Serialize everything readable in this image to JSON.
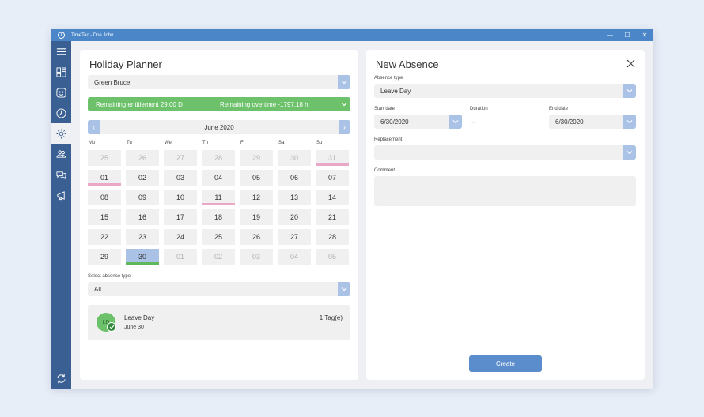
{
  "window": {
    "title": "TimeTac - Doe John",
    "minimize": "—",
    "maximize": "☐",
    "close": "✕",
    "app_icon": "T"
  },
  "sidebar": {
    "items": [
      {
        "icon": "hamburger-menu-icon"
      },
      {
        "icon": "dashboard-icon"
      },
      {
        "icon": "happy-face-icon"
      },
      {
        "icon": "clock-icon"
      },
      {
        "icon": "sun-icon",
        "active": true
      },
      {
        "icon": "team-icon"
      },
      {
        "icon": "chat-icon"
      },
      {
        "icon": "megaphone-icon"
      },
      {
        "icon": "sync-icon"
      }
    ]
  },
  "planner": {
    "title": "Holiday Planner",
    "employee": "Green Bruce",
    "remaining_entitlement": "Remaining entitlement 29.00 D",
    "remaining_overtime": "Remaining overtime -1797.18 h",
    "month": "June 2020",
    "prev": "‹",
    "next": "›",
    "weekdays": [
      "Mo",
      "Tu",
      "We",
      "Th",
      "Fr",
      "Sa",
      "Su"
    ],
    "weeks": [
      [
        {
          "d": "25",
          "o": true
        },
        {
          "d": "26",
          "o": true
        },
        {
          "d": "27",
          "o": true
        },
        {
          "d": "28",
          "o": true
        },
        {
          "d": "29",
          "o": true
        },
        {
          "d": "30",
          "o": true
        },
        {
          "d": "31",
          "o": true,
          "mark": "pink"
        }
      ],
      [
        {
          "d": "01",
          "mark": "pink"
        },
        {
          "d": "02"
        },
        {
          "d": "03"
        },
        {
          "d": "04"
        },
        {
          "d": "05"
        },
        {
          "d": "06"
        },
        {
          "d": "07"
        }
      ],
      [
        {
          "d": "08"
        },
        {
          "d": "09"
        },
        {
          "d": "10"
        },
        {
          "d": "11",
          "mark": "pink"
        },
        {
          "d": "12"
        },
        {
          "d": "13"
        },
        {
          "d": "14"
        }
      ],
      [
        {
          "d": "15"
        },
        {
          "d": "16"
        },
        {
          "d": "17"
        },
        {
          "d": "18"
        },
        {
          "d": "19"
        },
        {
          "d": "20"
        },
        {
          "d": "21"
        }
      ],
      [
        {
          "d": "22"
        },
        {
          "d": "23"
        },
        {
          "d": "24"
        },
        {
          "d": "25"
        },
        {
          "d": "26"
        },
        {
          "d": "27"
        },
        {
          "d": "28"
        }
      ],
      [
        {
          "d": "29"
        },
        {
          "d": "30",
          "selected": true,
          "mark": "green"
        },
        {
          "d": "01",
          "o": true
        },
        {
          "d": "02",
          "o": true
        },
        {
          "d": "03",
          "o": true
        },
        {
          "d": "04",
          "o": true
        },
        {
          "d": "05",
          "o": true
        }
      ]
    ],
    "absence_type_label": "Select absence type",
    "absence_type_value": "All",
    "card": {
      "avatar": "LD",
      "name": "Leave Day",
      "date": "June 30",
      "count": "1 Tag(e)"
    }
  },
  "new_absence": {
    "title": "New Absence",
    "absence_type_label": "Absence type",
    "absence_type_value": "Leave Day",
    "start_date_label": "Start date",
    "start_date_value": "6/30/2020",
    "duration_label": "Duration",
    "duration_value": "--",
    "end_date_label": "End date",
    "end_date_value": "6/30/2020",
    "replacement_label": "Replacement",
    "replacement_value": "",
    "comment_label": "Comment",
    "create_label": "Create"
  },
  "colors": {
    "accent": "#4a86c8",
    "sidebar": "#3a5f93",
    "green": "#6cc16a",
    "pink": "#e9a9c6",
    "selected": "#a9c2e6",
    "button": "#5b8dcc"
  }
}
